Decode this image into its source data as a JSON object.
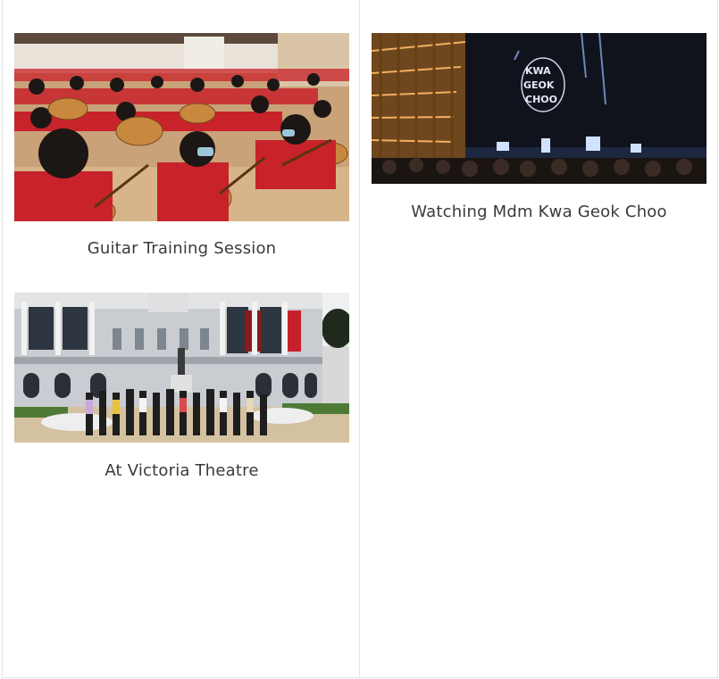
{
  "gallery": {
    "items": [
      {
        "caption": "Guitar Training Session",
        "image": "students-playing-guitars-photo"
      },
      {
        "caption": "Watching Mdm Kwa Geok Choo",
        "image": "theatre-stage-performance-photo"
      },
      {
        "caption": "At Victoria Theatre",
        "image": "group-at-victoria-theatre-photo"
      }
    ]
  }
}
